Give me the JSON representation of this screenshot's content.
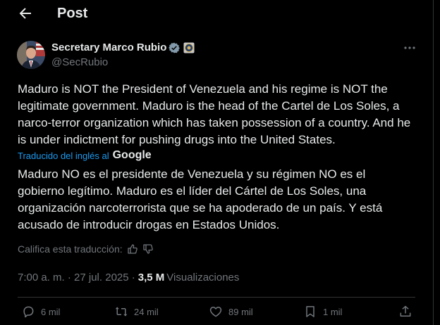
{
  "header": {
    "title": "Post"
  },
  "author": {
    "name": "Secretary Marco Rubio",
    "handle": "@SecRubio"
  },
  "tweet": {
    "text": "Maduro is NOT the President of Venezuela and his regime is NOT the legitimate government.  Maduro is the head of the Cartel de Los Soles, a narco-terror organization which has taken possession of a country.  And he is under indictment for pushing drugs into the United States."
  },
  "translation": {
    "label": "Traducido del inglés al",
    "provider": "Google",
    "text": "Maduro NO es el presidente de Venezuela y su régimen NO es el gobierno legítimo. Maduro es el líder del Cártel de Los Soles, una organización narcoterrorista que se ha apoderado de un país. Y está acusado de introducir drogas en Estados Unidos.",
    "rate_label": "Califica esta traducción:"
  },
  "meta": {
    "timestamp": "7:00 a. m. · 27 jul. 2025 ·",
    "views_count": "3,5 M",
    "views_label": "Visualizaciones"
  },
  "actions": {
    "replies": "6 mil",
    "reposts": "24 mil",
    "likes": "89 mil",
    "bookmarks": "1 mil"
  },
  "colors": {
    "background": "#000000",
    "text": "#e7e9ea",
    "muted": "#71767b",
    "accent": "#1d9bf0",
    "divider": "#2f3336"
  },
  "icons": [
    "back-arrow-icon",
    "verified-badge-icon",
    "government-seal-icon",
    "more-icon",
    "thumbs-up-icon",
    "thumbs-down-icon",
    "reply-icon",
    "repost-icon",
    "like-icon",
    "bookmark-icon",
    "share-icon"
  ]
}
